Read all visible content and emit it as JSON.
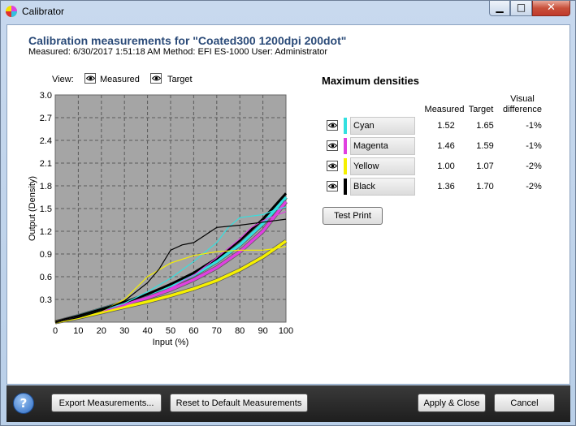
{
  "window": {
    "title": "Calibrator",
    "minimize_glyph": "▁",
    "maximize_glyph": "□",
    "close_glyph": "✕"
  },
  "header": {
    "title": "Calibration measurements for \"Coated300 1200dpi  200dot\"",
    "subline": "Measured: 6/30/2017 1:51:18 AM   Method: EFI ES-1000   User: Administrator"
  },
  "view": {
    "label": "View:",
    "measured": "Measured",
    "target": "Target"
  },
  "chart_data": {
    "type": "line",
    "xlabel": "Input (%)",
    "ylabel": "Output (Density)",
    "xlim": [
      0,
      100
    ],
    "ylim": [
      0,
      3.0
    ],
    "xticks": [
      "0",
      "10",
      "20",
      "30",
      "40",
      "50",
      "60",
      "70",
      "80",
      "90",
      "100"
    ],
    "yticks": [
      "0.3",
      "0.6",
      "0.9",
      "1.2",
      "1.5",
      "1.8",
      "2.1",
      "2.4",
      "2.7",
      "3.0"
    ],
    "grid": true,
    "series": [
      {
        "name": "Cyan",
        "kind": "target",
        "color": "#33e0e0",
        "x": [
          0,
          10,
          20,
          30,
          40,
          50,
          60,
          70,
          80,
          90,
          100
        ],
        "y": [
          0,
          0.08,
          0.17,
          0.26,
          0.36,
          0.48,
          0.62,
          0.8,
          1.02,
          1.3,
          1.65
        ]
      },
      {
        "name": "Magenta",
        "kind": "target",
        "color": "#e040e0",
        "x": [
          0,
          10,
          20,
          30,
          40,
          50,
          60,
          70,
          80,
          90,
          100
        ],
        "y": [
          0,
          0.07,
          0.15,
          0.23,
          0.32,
          0.43,
          0.56,
          0.72,
          0.93,
          1.2,
          1.59
        ]
      },
      {
        "name": "Yellow",
        "kind": "target",
        "color": "#f5f000",
        "x": [
          0,
          10,
          20,
          30,
          40,
          50,
          60,
          70,
          80,
          90,
          100
        ],
        "y": [
          0,
          0.06,
          0.13,
          0.2,
          0.27,
          0.35,
          0.44,
          0.55,
          0.69,
          0.86,
          1.07
        ]
      },
      {
        "name": "Black",
        "kind": "target",
        "color": "#000000",
        "x": [
          0,
          10,
          20,
          30,
          40,
          50,
          60,
          70,
          80,
          90,
          100
        ],
        "y": [
          0,
          0.08,
          0.17,
          0.26,
          0.37,
          0.5,
          0.65,
          0.84,
          1.08,
          1.36,
          1.7
        ]
      },
      {
        "name": "Cyan",
        "kind": "measured",
        "color": "#33e0e0",
        "x": [
          0,
          10,
          20,
          30,
          40,
          50,
          60,
          70,
          75,
          80,
          85,
          90,
          95,
          100
        ],
        "y": [
          0,
          0.06,
          0.15,
          0.25,
          0.4,
          0.58,
          0.8,
          1.05,
          1.25,
          1.38,
          1.4,
          1.42,
          1.48,
          1.52
        ]
      },
      {
        "name": "Magenta",
        "kind": "measured",
        "color": "#e040e0",
        "x": [
          0,
          10,
          20,
          30,
          40,
          50,
          60,
          70,
          80,
          85,
          90,
          95,
          100
        ],
        "y": [
          0,
          0.06,
          0.14,
          0.22,
          0.32,
          0.45,
          0.62,
          0.85,
          1.1,
          1.25,
          1.34,
          1.4,
          1.46
        ]
      },
      {
        "name": "Yellow",
        "kind": "measured",
        "color": "#f5f000",
        "x": [
          0,
          10,
          20,
          30,
          40,
          50,
          60,
          70,
          80,
          90,
          95,
          100
        ],
        "y": [
          0,
          0.05,
          0.14,
          0.3,
          0.6,
          0.78,
          0.88,
          0.93,
          0.95,
          0.95,
          0.97,
          1.0
        ]
      },
      {
        "name": "Black",
        "kind": "measured",
        "color": "#000000",
        "x": [
          0,
          10,
          20,
          30,
          40,
          45,
          50,
          55,
          60,
          65,
          70,
          80,
          90,
          100
        ],
        "y": [
          0,
          0.06,
          0.15,
          0.28,
          0.52,
          0.7,
          0.95,
          1.02,
          1.05,
          1.15,
          1.25,
          1.28,
          1.32,
          1.36
        ]
      }
    ]
  },
  "densities": {
    "title": "Maximum densities",
    "headers": {
      "measured": "Measured",
      "target": "Target",
      "visual_1": "Visual",
      "visual_2": "difference"
    },
    "rows": [
      {
        "name": "Cyan",
        "color": "#33e0e0",
        "measured": "1.52",
        "target": "1.65",
        "diff": "-1%"
      },
      {
        "name": "Magenta",
        "color": "#e040e0",
        "measured": "1.46",
        "target": "1.59",
        "diff": "-1%"
      },
      {
        "name": "Yellow",
        "color": "#f5f000",
        "measured": "1.00",
        "target": "1.07",
        "diff": "-2%"
      },
      {
        "name": "Black",
        "color": "#000000",
        "measured": "1.36",
        "target": "1.70",
        "diff": "-2%"
      }
    ],
    "test_print": "Test Print"
  },
  "footer": {
    "help": "?",
    "export": "Export Measurements...",
    "reset": "Reset to Default Measurements",
    "apply": "Apply & Close",
    "cancel": "Cancel"
  }
}
